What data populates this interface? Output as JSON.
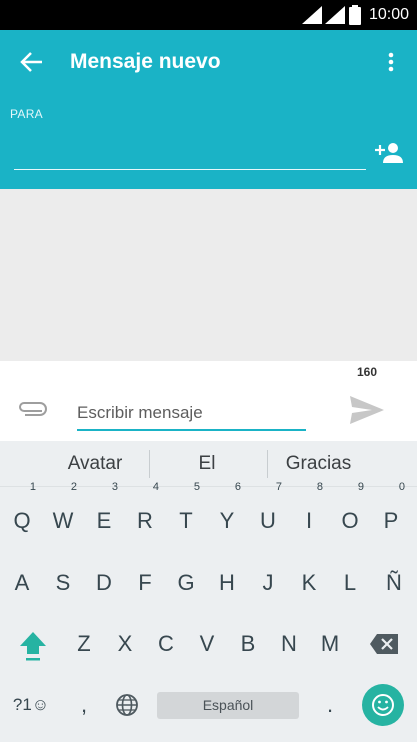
{
  "status": {
    "time": "10:00"
  },
  "header": {
    "title": "Mensaje nuevo",
    "to_label": "PARA",
    "to_value": ""
  },
  "compose": {
    "char_count": "160",
    "placeholder": "Escribir mensaje"
  },
  "suggestions": [
    "Avatar",
    "El",
    "Gracias"
  ],
  "keyboard": {
    "row1": [
      {
        "k": "Q",
        "h": "1"
      },
      {
        "k": "W",
        "h": "2"
      },
      {
        "k": "E",
        "h": "3"
      },
      {
        "k": "R",
        "h": "4"
      },
      {
        "k": "T",
        "h": "5"
      },
      {
        "k": "Y",
        "h": "6"
      },
      {
        "k": "U",
        "h": "7"
      },
      {
        "k": "I",
        "h": "8"
      },
      {
        "k": "O",
        "h": "9"
      },
      {
        "k": "P",
        "h": "0"
      }
    ],
    "row2": [
      "A",
      "S",
      "D",
      "F",
      "G",
      "H",
      "J",
      "K",
      "L",
      "Ñ"
    ],
    "row3": [
      "Z",
      "X",
      "C",
      "V",
      "B",
      "N",
      "M"
    ],
    "symbols": "?1☺",
    "comma": ",",
    "period": ".",
    "space_label": "Español"
  },
  "colors": {
    "accent": "#1ab3c6",
    "emoji_button": "#26b3a2"
  }
}
